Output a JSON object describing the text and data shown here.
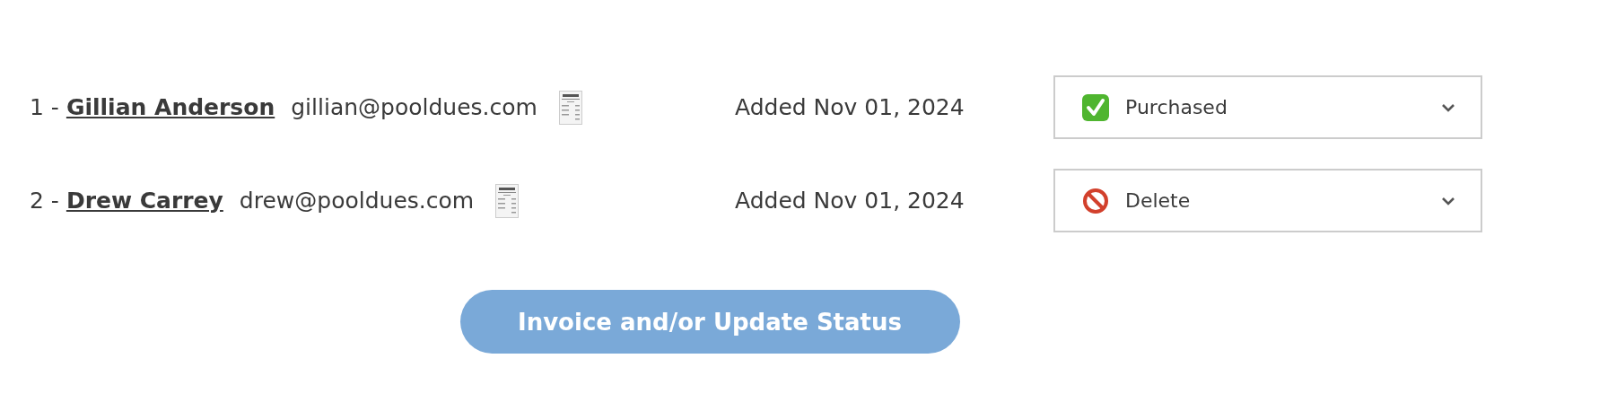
{
  "members": [
    {
      "number": "1",
      "separator": "-",
      "name": "Gillian Anderson",
      "email": "gillian@pooldues.com",
      "added": "Added Nov 01, 2024",
      "status": {
        "kind": "purchased",
        "label": "Purchased"
      }
    },
    {
      "number": "2",
      "separator": "-",
      "name": "Drew Carrey",
      "email": "drew@pooldues.com",
      "added": "Added Nov 01, 2024",
      "status": {
        "kind": "delete",
        "label": "Delete"
      }
    }
  ],
  "submit_button": "Invoice and/or Update Status"
}
